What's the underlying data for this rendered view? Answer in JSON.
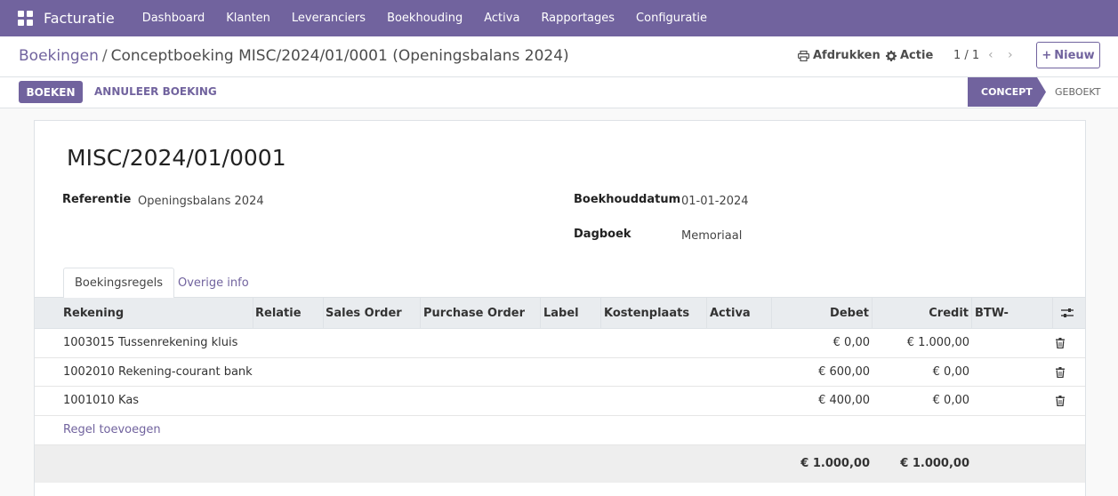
{
  "navbar": {
    "brand": "Facturatie",
    "items": [
      "Dashboard",
      "Klanten",
      "Leveranciers",
      "Boekhouding",
      "Activa",
      "Rapportages",
      "Configuratie"
    ]
  },
  "breadcrumb": {
    "parent": "Boekingen",
    "separator": "/",
    "current": "Conceptboeking MISC/2024/01/0001 (Openingsbalans 2024)"
  },
  "toolbar": {
    "print_label": "Afdrukken",
    "action_label": "Actie",
    "pager": "1 / 1",
    "prev": "‹",
    "next": "›",
    "new_label": "Nieuw"
  },
  "statusbar": {
    "post_label": "BOEKEN",
    "cancel_label": "ANNULEER BOEKING",
    "current_state": "CONCEPT",
    "next_state": "GEBOEKT"
  },
  "record": {
    "name": "MISC/2024/01/0001",
    "reference_label": "Referentie",
    "reference": "Openingsbalans 2024",
    "date_label": "Boekhouddatum",
    "date": "01-01-2024",
    "journal_label": "Dagboek",
    "journal": "Memoriaal"
  },
  "tabs": [
    "Boekingsregels",
    "Overige info"
  ],
  "table": {
    "columns": [
      "Rekening",
      "Relatie",
      "Sales Order",
      "Purchase Order",
      "Label",
      "Kostenplaats",
      "Activa",
      "Debet",
      "Credit",
      "BTW-rubriek"
    ],
    "rows": [
      {
        "account": "1003015 Tussenrekening kluis",
        "debit": "€ 0,00",
        "credit": "€ 1.000,00"
      },
      {
        "account": "1002010 Rekening-courant bank",
        "debit": "€ 600,00",
        "credit": "€ 0,00"
      },
      {
        "account": "1001010 Kas",
        "debit": "€ 400,00",
        "credit": "€ 0,00"
      }
    ],
    "add_line_label": "Regel toevoegen",
    "total_debit": "€ 1.000,00",
    "total_credit": "€ 1.000,00"
  },
  "colors": {
    "primary": "#71639e",
    "navbar": "#71639e"
  },
  "icons": {
    "apps": "apps-grid-icon",
    "print": "printer-icon",
    "action": "gear-icon",
    "delete": "trash-icon",
    "settings": "sliders-icon",
    "new": "plus-icon"
  }
}
